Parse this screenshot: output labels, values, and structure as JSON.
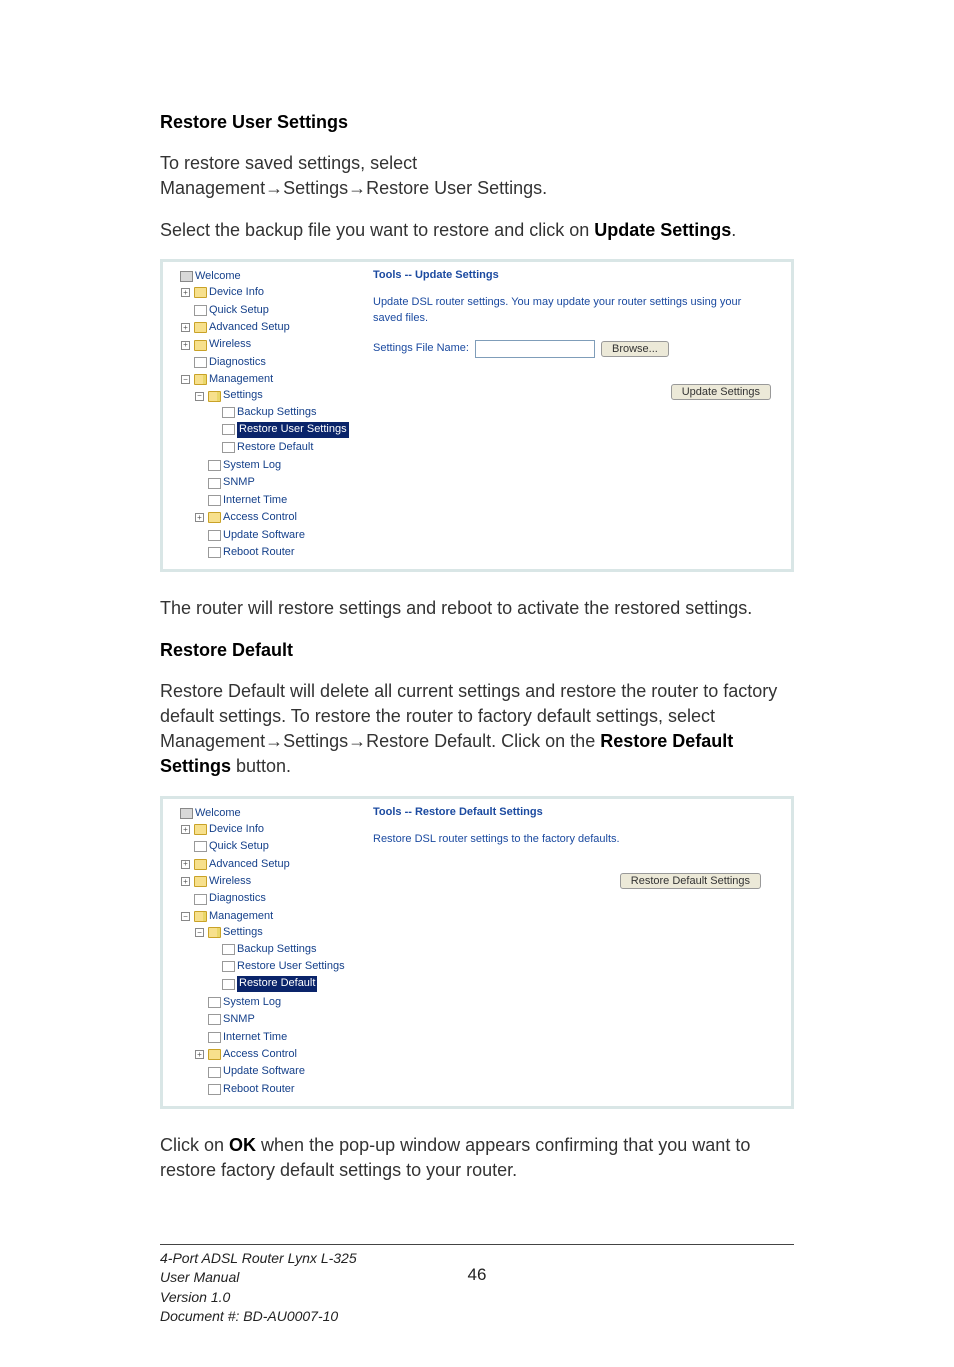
{
  "doc": {
    "heading1": "Restore User Settings",
    "para1a": "To restore saved settings, select",
    "para1b": "Management→Settings→Restore User Settings.",
    "para2a": "Select the backup file you want to restore and click on ",
    "para2b": "Update Settings",
    "para2c": ".",
    "para3": "The router will restore settings and reboot to activate the restored settings.",
    "heading2": "Restore Default",
    "para4a": "Restore Default will delete all current settings and restore the router to factory default settings. To restore the router to factory default settings, select Management→Settings→Restore Default. Click on the ",
    "para4b": "Restore Default Settings",
    "para4c": " button.",
    "para5a": "Click on ",
    "para5b": "OK",
    "para5c": " when the pop-up window appears confirming that you want to restore factory default settings to your router."
  },
  "shot1": {
    "title": "Tools -- Update Settings",
    "desc": "Update DSL router settings. You may update your router settings using your saved files.",
    "file_label": "Settings File Name:",
    "browse": "Browse...",
    "submit": "Update Settings",
    "tree": {
      "root": "Welcome",
      "device_info": "Device Info",
      "quick_setup": "Quick Setup",
      "advanced_setup": "Advanced Setup",
      "wireless": "Wireless",
      "diagnostics": "Diagnostics",
      "management": "Management",
      "settings": "Settings",
      "backup": "Backup Settings",
      "restore_user": "Restore User Settings",
      "restore_default": "Restore Default",
      "system_log": "System Log",
      "snmp": "SNMP",
      "internet_time": "Internet Time",
      "access_control": "Access Control",
      "update_software": "Update Software",
      "reboot_router": "Reboot Router"
    }
  },
  "shot2": {
    "title": "Tools -- Restore Default Settings",
    "desc": "Restore DSL router settings to the factory defaults.",
    "submit": "Restore Default Settings",
    "tree": {
      "root": "Welcome",
      "device_info": "Device Info",
      "quick_setup": "Quick Setup",
      "advanced_setup": "Advanced Setup",
      "wireless": "Wireless",
      "diagnostics": "Diagnostics",
      "management": "Management",
      "settings": "Settings",
      "backup": "Backup Settings",
      "restore_user": "Restore User Settings",
      "restore_default": "Restore Default",
      "system_log": "System Log",
      "snmp": "SNMP",
      "internet_time": "Internet Time",
      "access_control": "Access Control",
      "update_software": "Update Software",
      "reboot_router": "Reboot Router"
    }
  },
  "footer": {
    "line1": "4-Port ADSL Router Lynx L-325",
    "line2": "User Manual",
    "line3": "Version 1.0",
    "line4": "Document #:  BD-AU0007-10",
    "page": "46"
  }
}
